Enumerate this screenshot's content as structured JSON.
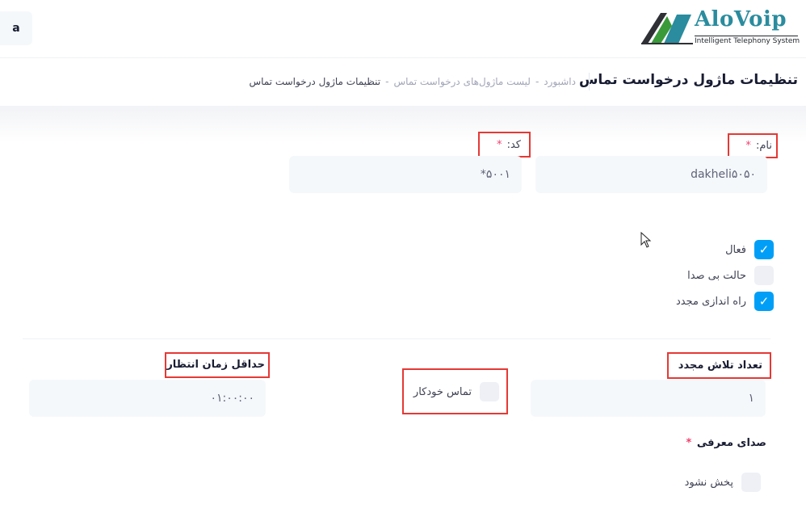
{
  "header": {
    "user_initial": "a",
    "logo": {
      "name": "AloVoip",
      "tagline": "Intelligent Telephony System"
    }
  },
  "subheader": {
    "title": "تنظیمات ماژول درخواست تماس",
    "breadcrumb": [
      "داشبورد",
      "لیست ماژول‌های درخواست تماس",
      "تنظیمات ماژول درخواست تماس"
    ],
    "separator": "-"
  },
  "form": {
    "name": {
      "label": "نام:",
      "required_mark": "*",
      "value": "dakheli۵۰۵۰"
    },
    "code": {
      "label": "کد:",
      "required_mark": "*",
      "value": "*۵۰۰۱"
    },
    "checks": [
      {
        "label": "فعال",
        "checked": true
      },
      {
        "label": "حالت بی صدا",
        "checked": false
      },
      {
        "label": "راه اندازی مجدد",
        "checked": true
      }
    ],
    "retry_count": {
      "label": "تعداد تلاش مجدد",
      "value": "۱"
    },
    "auto_call": {
      "label": "تماس خودکار",
      "checked": false
    },
    "min_wait": {
      "label": "حداقل زمان انتظار",
      "value": "۰۱:۰۰:۰۰"
    },
    "intro_sound": {
      "label": "صدای معرفی",
      "required_mark": "*"
    },
    "no_play": {
      "label": "پخش نشود",
      "checked": false
    }
  },
  "colors": {
    "accent": "#009ef7",
    "highlight": "#e53935",
    "required": "#f1416c",
    "logo": "#2a8c9e"
  }
}
